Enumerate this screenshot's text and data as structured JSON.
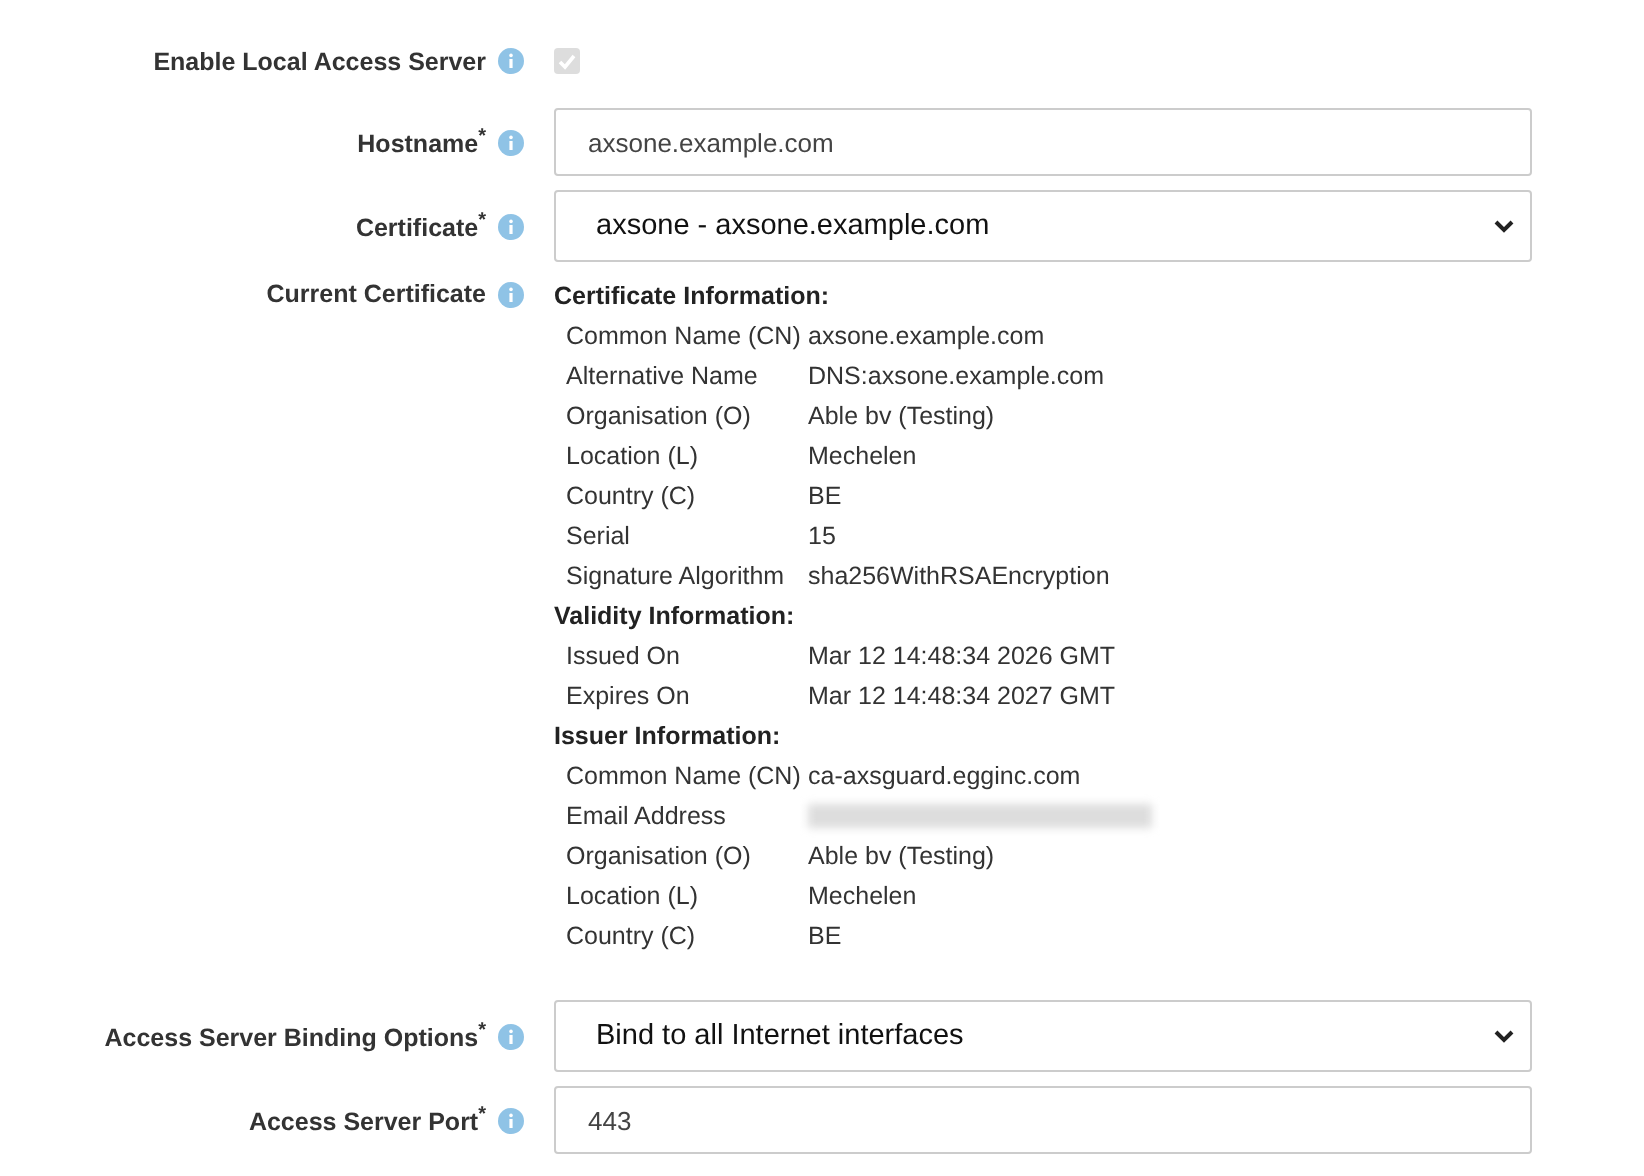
{
  "fields": [
    {
      "kind": "checkbox",
      "label": "Enable Local Access Server",
      "checked": true,
      "disabled": true
    },
    {
      "kind": "text",
      "label": "Hostname",
      "mark": "*",
      "value": "axsone.example.com"
    },
    {
      "kind": "select",
      "label": "Certificate",
      "mark": "*",
      "value": "axsone - axsone.example.com"
    },
    {
      "kind": "certificate",
      "label": "Current Certificate",
      "sections": [
        {
          "title": "Certificate Information:",
          "rows": [
            {
              "name": "Common Name (CN)",
              "value": "axsone.example.com"
            },
            {
              "name": "Alternative Name",
              "value": "DNS:axsone.example.com"
            },
            {
              "name": "Organisation (O)",
              "value": "Able bv (Testing)"
            },
            {
              "name": "Location (L)",
              "value": "Mechelen"
            },
            {
              "name": "Country (C)",
              "value": "BE"
            },
            {
              "name": "Serial",
              "value": "15"
            },
            {
              "name": "Signature Algorithm",
              "value": "sha256WithRSAEncryption"
            }
          ]
        },
        {
          "title": "Validity Information:",
          "rows": [
            {
              "name": "Issued On",
              "value": "Mar 12 14:48:34 2026 GMT"
            },
            {
              "name": "Expires On",
              "value": "Mar 12 14:48:34 2027 GMT"
            }
          ]
        },
        {
          "title": "Issuer Information:",
          "rows": [
            {
              "name": "Common Name (CN)",
              "value": "ca-axsguard.egginc.com"
            },
            {
              "name": "Email Address",
              "redacted": true
            },
            {
              "name": "Organisation (O)",
              "value": "Able bv (Testing)"
            },
            {
              "name": "Location (L)",
              "value": "Mechelen"
            },
            {
              "name": "Country (C)",
              "value": "BE"
            }
          ]
        }
      ]
    },
    {
      "kind": "select",
      "label": "Access Server Binding Options",
      "mark": "*",
      "value": "Bind to all Internet interfaces"
    },
    {
      "kind": "text",
      "label": "Access Server Port",
      "mark": "*",
      "value": "443"
    }
  ]
}
